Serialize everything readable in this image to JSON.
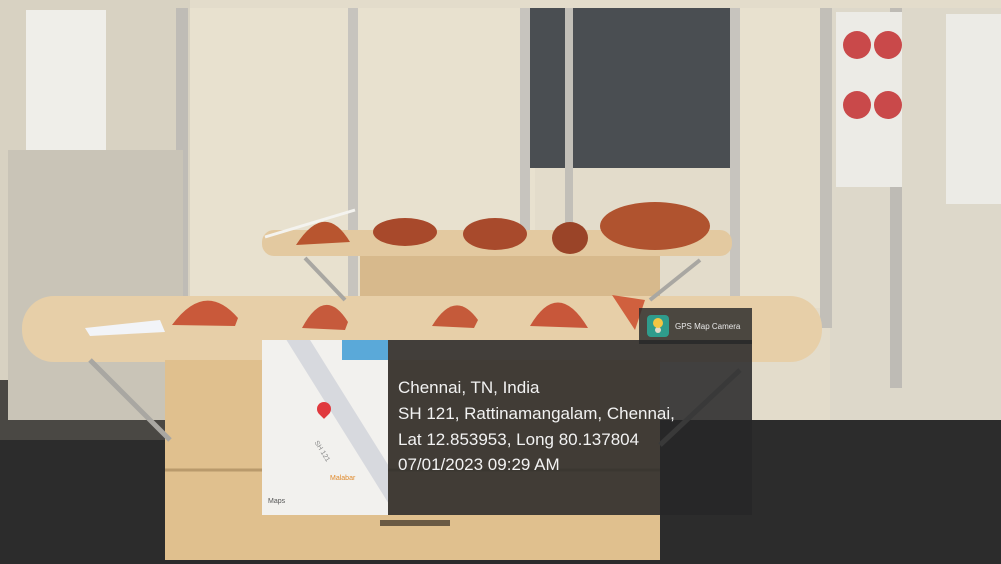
{
  "photo": {
    "subject": "exhibition-table-with-specimens"
  },
  "stamp": {
    "app_name": "GPS Map Camera",
    "location_title": "Chennai, TN, India",
    "address": "SH 121, Rattinamangalam, Chennai,",
    "coordinates": "Lat 12.853953, Long 80.137804",
    "datetime": "07/01/2023 09:29 AM",
    "map": {
      "road_label": "SH 121",
      "poi_label": "Malabar",
      "brand": "Maps"
    }
  },
  "colors": {
    "wall": "#e6dfcf",
    "table_top": "#e7cfa8",
    "specimen": "#c9593a",
    "stamp_panel": "#262628"
  }
}
